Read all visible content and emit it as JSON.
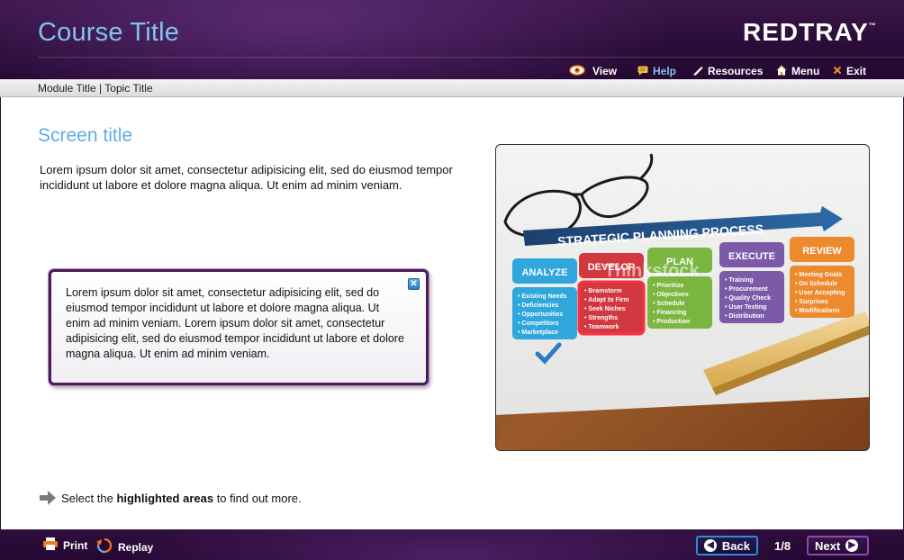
{
  "header": {
    "course_title": "Course Title",
    "brand": "REDTRAY",
    "brand_mark": "™",
    "nav": [
      {
        "label": "View",
        "icon": "eye-icon"
      },
      {
        "label": "Help",
        "icon": "chat-bubble-icon"
      },
      {
        "label": "Resources",
        "icon": "pencil-icon"
      },
      {
        "label": "Menu",
        "icon": "home-icon"
      },
      {
        "label": "Exit",
        "icon": "close-x-icon"
      }
    ],
    "active_nav": "Help"
  },
  "breadcrumb": "Module Title | Topic Title",
  "main": {
    "screen_title": "Screen title",
    "intro": "Lorem ipsum dolor sit amet, consectetur adipisicing elit, sed do eiusmod tempor incididunt ut labore et dolore magna aliqua. Ut enim ad minim veniam.",
    "popup_text": "Lorem ipsum dolor sit amet, consectetur adipisicing elit, sed do eiusmod tempor incididunt ut labore et dolore magna aliqua. Ut enim ad minim veniam. Lorem ipsum dolor sit amet, consectetur adipisicing elit, sed do eiusmod tempor incididunt ut labore et dolore magna aliqua. Ut enim ad minim veniam.",
    "popup_close": "✕",
    "instruction_pre": "Select the ",
    "instruction_bold": "highlighted areas",
    "instruction_post": " to find out more."
  },
  "photo": {
    "banner": "STRATEGIC PLANNING PROCESS",
    "watermark": "Thinkstock",
    "steps": [
      {
        "label": "ANALYZE",
        "color": "#2fa6dc",
        "items": [
          "Existing Needs",
          "Deficiencies",
          "Opportunities",
          "Competitors",
          "Marketplace"
        ]
      },
      {
        "label": "DEVELOP",
        "color": "#d2383f",
        "items": [
          "Brainstorm",
          "Adapt to Firm",
          "Seek Niches",
          "Strengths",
          "Teamwork"
        ]
      },
      {
        "label": "PLAN",
        "color": "#7ab640",
        "items": [
          "Prioritize",
          "Objectives",
          "Schedule",
          "Financing",
          "Production"
        ]
      },
      {
        "label": "EXECUTE",
        "color": "#7b5aa8",
        "items": [
          "Training",
          "Procurement",
          "Quality Check",
          "User Testing",
          "Distribution"
        ]
      },
      {
        "label": "REVIEW",
        "color": "#ee8a2e",
        "items": [
          "Meeting Goals",
          "On Schedule",
          "User Accepting",
          "Surprises",
          "Modifications"
        ]
      }
    ]
  },
  "footer": {
    "print": "Print",
    "replay": "Replay",
    "back": "Back",
    "next": "Next",
    "page": "1/8"
  },
  "colors": {
    "accent_blue": "#5aaee8",
    "header_purple": "#2a0c38",
    "next_border": "#8e4aa8",
    "back_border": "#2f8ad8"
  }
}
